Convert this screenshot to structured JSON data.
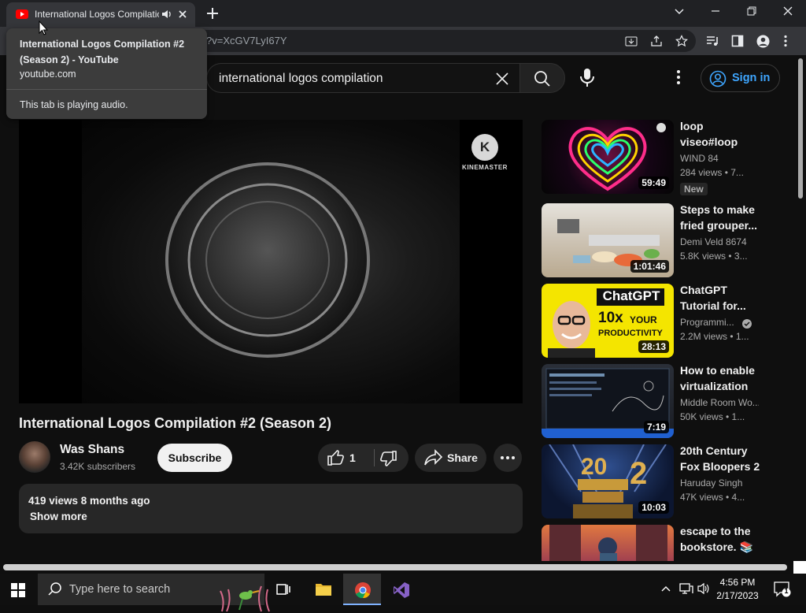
{
  "browser": {
    "tab_title": "International Logos Compilation #2 (Season 2) - YouTube",
    "url_fragment": "?v=XcGV7LyI67Y"
  },
  "tooltip": {
    "title": "International Logos Compilation #2 (Season 2) - YouTube",
    "domain": "youtube.com",
    "status": "This tab is playing audio."
  },
  "youtube": {
    "search_query": "international logos compilation",
    "sign_in": "Sign in",
    "watermark": "KINEMASTER",
    "video_title": "International Logos Compilation #2 (Season 2)",
    "channel": "Was Shans",
    "subscribers": "3.42K subscribers",
    "subscribe_label": "Subscribe",
    "like_count": "1",
    "share_label": "Share",
    "description_meta": "419 views  8 months ago",
    "show_more": "Show more"
  },
  "recommendations": [
    {
      "title": "loop viseo#loop",
      "channel": "WIND 84",
      "meta": "284 views • 7...",
      "badge": "New",
      "duration": "59:49"
    },
    {
      "title": "Steps to make fried grouper...",
      "channel": "Demi Veld 8674",
      "meta": "5.8K views • 3...",
      "duration": "1:01:46"
    },
    {
      "title": "ChatGPT Tutorial for...",
      "channel": "Programmi...",
      "meta": "2.2M views • 1...",
      "duration": "28:13",
      "thumb_text_1": "ChatGPT",
      "thumb_text_2": "10x",
      "thumb_text_3": "YOUR",
      "thumb_text_4": "PRODUCTIVITY"
    },
    {
      "title": "How to enable virtualization i...",
      "channel": "Middle Room Wo...",
      "meta": "50K views • 1...",
      "duration": "7:19"
    },
    {
      "title": "20th Century Fox Bloopers 2",
      "channel": "Haruday Singh",
      "meta": "47K views • 4...",
      "duration": "10:03"
    },
    {
      "title": "escape to the bookstore. 📚 ...",
      "channel": "",
      "meta": ""
    }
  ],
  "taskbar": {
    "search_placeholder": "Type here to search",
    "time": "4:56 PM",
    "date": "2/17/2023",
    "notification_count": "1"
  }
}
